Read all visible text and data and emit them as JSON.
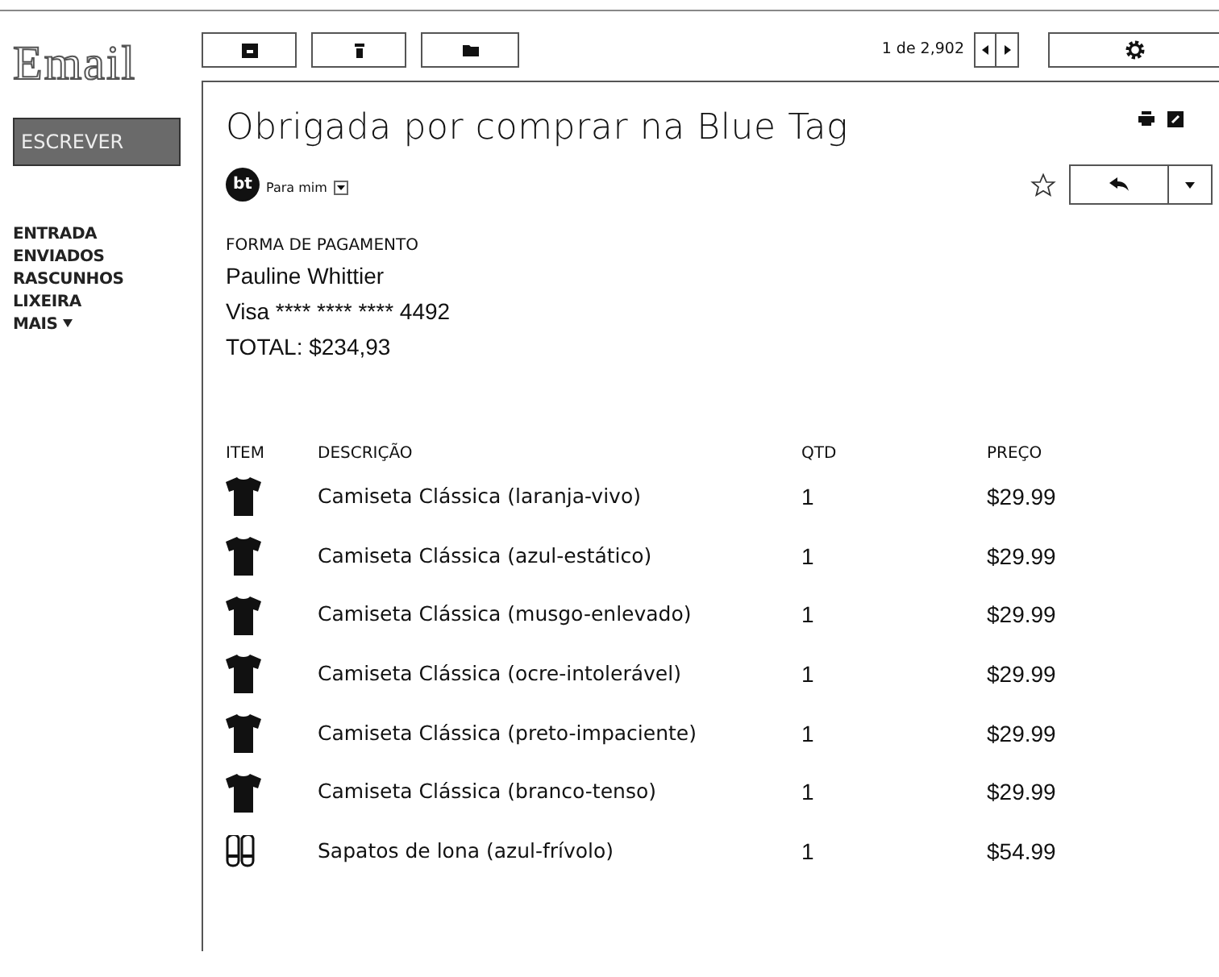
{
  "logo": "Email",
  "compose_button": "ESCREVER",
  "sidebar": {
    "items": [
      {
        "label": "ENTRADA",
        "kind": "link"
      },
      {
        "label": "ENVIADOS",
        "kind": "link"
      },
      {
        "label": "RASCUNHOS",
        "kind": "link"
      },
      {
        "label": "LIXEIRA",
        "kind": "link"
      },
      {
        "label": "MAIS",
        "kind": "menu"
      }
    ]
  },
  "pager": {
    "text": "1 de 2,902"
  },
  "message": {
    "subject": "Obrigada por comprar na Blue Tag",
    "sender_initials": "bt",
    "recipient": "Para mim",
    "starred": false,
    "payment": {
      "heading": "FORMA DE PAGAMENTO",
      "name": "Pauline Whittier",
      "card": "Visa **** **** **** 4492",
      "total": "TOTAL: $234,93"
    },
    "table": {
      "columns": [
        "ITEM",
        "DESCRIÇÃO",
        "QTD",
        "PREÇO"
      ],
      "rows": [
        {
          "kind": "shirt",
          "description": "Camiseta Clássica (laranja-vivo)",
          "qty": "1",
          "price": "$29.99"
        },
        {
          "kind": "shirt",
          "description": "Camiseta Clássica (azul-estático)",
          "qty": "1",
          "price": "$29.99"
        },
        {
          "kind": "shirt",
          "description": "Camiseta Clássica (musgo-enlevado)",
          "qty": "1",
          "price": "$29.99"
        },
        {
          "kind": "shirt",
          "description": "Camiseta Clássica (ocre-intolerável)",
          "qty": "1",
          "price": "$29.99"
        },
        {
          "kind": "shirt",
          "description": "Camiseta Clássica (preto-impaciente)",
          "qty": "1",
          "price": "$29.99"
        },
        {
          "kind": "shirt",
          "description": "Camiseta Clássica (branco-tenso)",
          "qty": "1",
          "price": "$29.99"
        },
        {
          "kind": "shoes",
          "description": "Sapatos de lona (azul-frívolo)",
          "qty": "1",
          "price": "$54.99"
        }
      ]
    }
  }
}
